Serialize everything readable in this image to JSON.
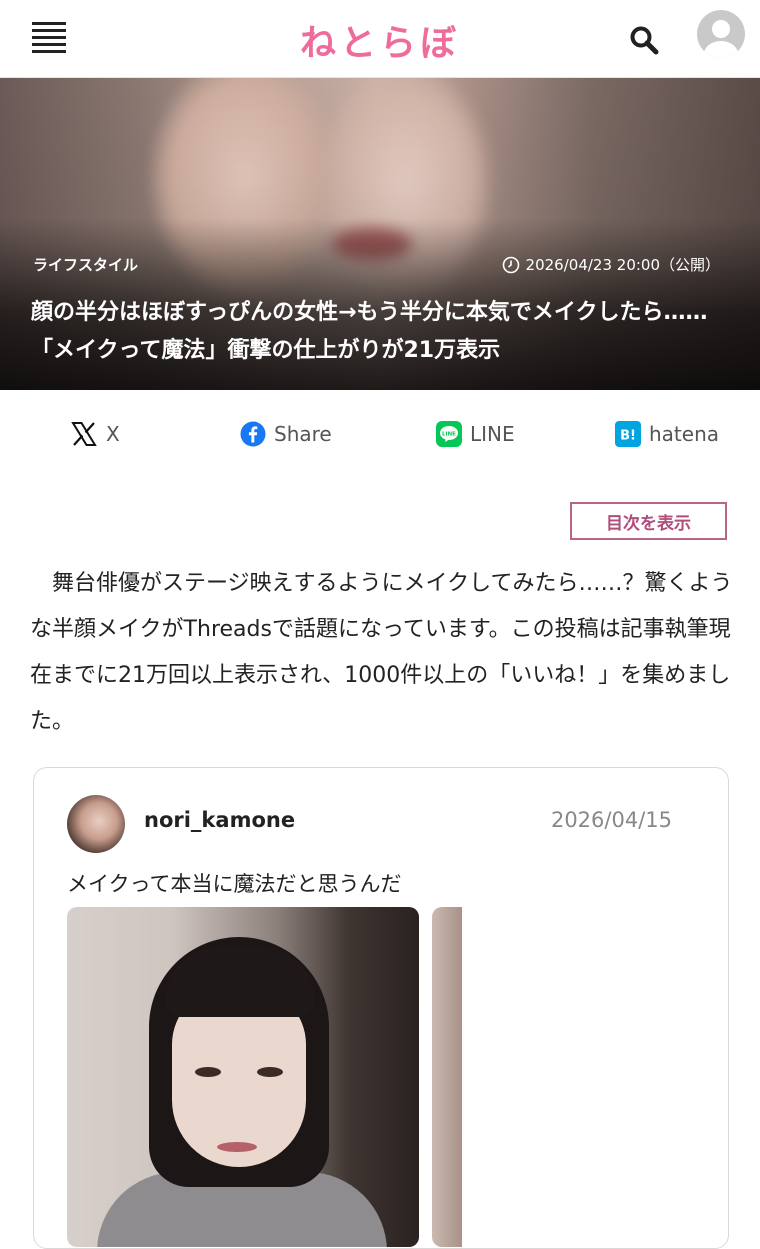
{
  "header": {
    "logo": "ねとらぼ",
    "menu_icon": "hamburger-menu-icon",
    "search_icon": "search-icon",
    "account_icon": "user-avatar-icon",
    "brand_color": "#ee6b9c"
  },
  "hero": {
    "category": "ライフスタイル",
    "date": "2026/04/23 20:00（公開）",
    "title": "顔の半分はほぼすっぴんの女性→もう半分に本気でメイクしたら……「メイクって魔法」衝撃の仕上がりが21万表示"
  },
  "share": {
    "x_label": "X",
    "facebook_label": "Share",
    "line_label": "LINE",
    "hatena_label": "hatena"
  },
  "toc_label": "目次を表示",
  "article": {
    "paragraph": "舞台俳優がステージ映えするようにメイクしてみたら……？驚くような半顔メイクがThreadsで話題になっています。この投稿は記事執筆現在までに21万回以上表示され、1000件以上の「いいね！」を集めました。"
  },
  "embed": {
    "username": "nori_kamone",
    "date": "2026/04/15",
    "text": "メイクって本当に魔法だと思うんだ"
  }
}
